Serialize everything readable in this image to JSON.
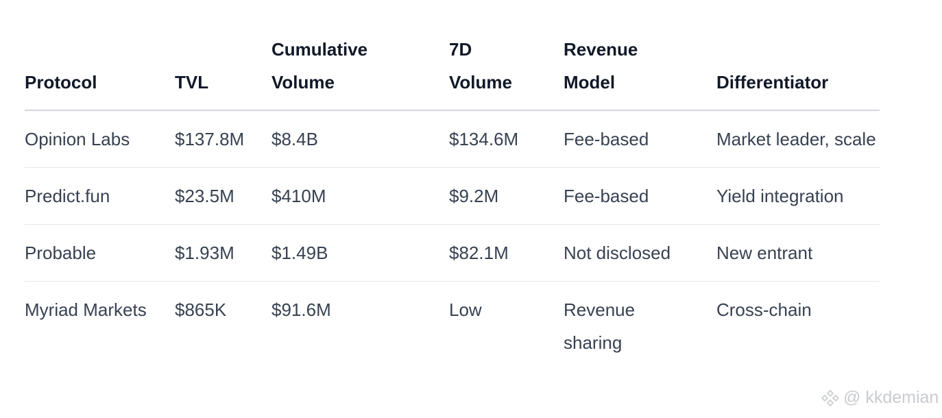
{
  "table": {
    "headers": [
      "Protocol",
      "TVL",
      "Cumulative Volume",
      "7D Volume",
      "Revenue Model",
      "Differentiator"
    ],
    "rows": [
      [
        "Opinion Labs",
        "$137.8M",
        "$8.4B",
        "$134.6M",
        "Fee-based",
        "Market leader, scale"
      ],
      [
        "Predict.fun",
        "$23.5M",
        "$410M",
        "$9.2M",
        "Fee-based",
        "Yield integration"
      ],
      [
        "Probable",
        "$1.93M",
        "$1.49B",
        "$82.1M",
        "Not disclosed",
        "New entrant"
      ],
      [
        "Myriad Markets",
        "$865K",
        "$91.6M",
        "Low",
        "Revenue sharing",
        "Cross-chain"
      ]
    ]
  },
  "watermark": {
    "text": "@ kkdemian",
    "icon": "binance-logo-icon"
  }
}
